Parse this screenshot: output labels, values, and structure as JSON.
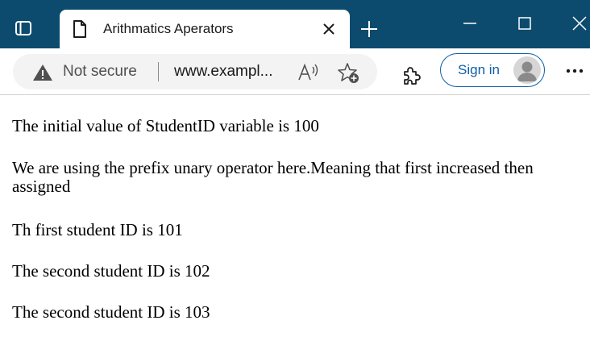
{
  "browser": {
    "tab": {
      "title": "Arithmatics Aperators"
    },
    "address_bar": {
      "security_label": "Not secure",
      "url": "www.exampl..."
    },
    "signin_label": "Sign in",
    "colors": {
      "titlebar": "#0c4b6e",
      "accent": "#0f5ea8"
    }
  },
  "page": {
    "lines": [
      "The initial value of StudentID variable is 100",
      "We are using the prefix unary operator here.Meaning that first increased then assigned",
      "Th first student ID is 101",
      "The second student ID is 102",
      "The second student ID is 103"
    ]
  }
}
